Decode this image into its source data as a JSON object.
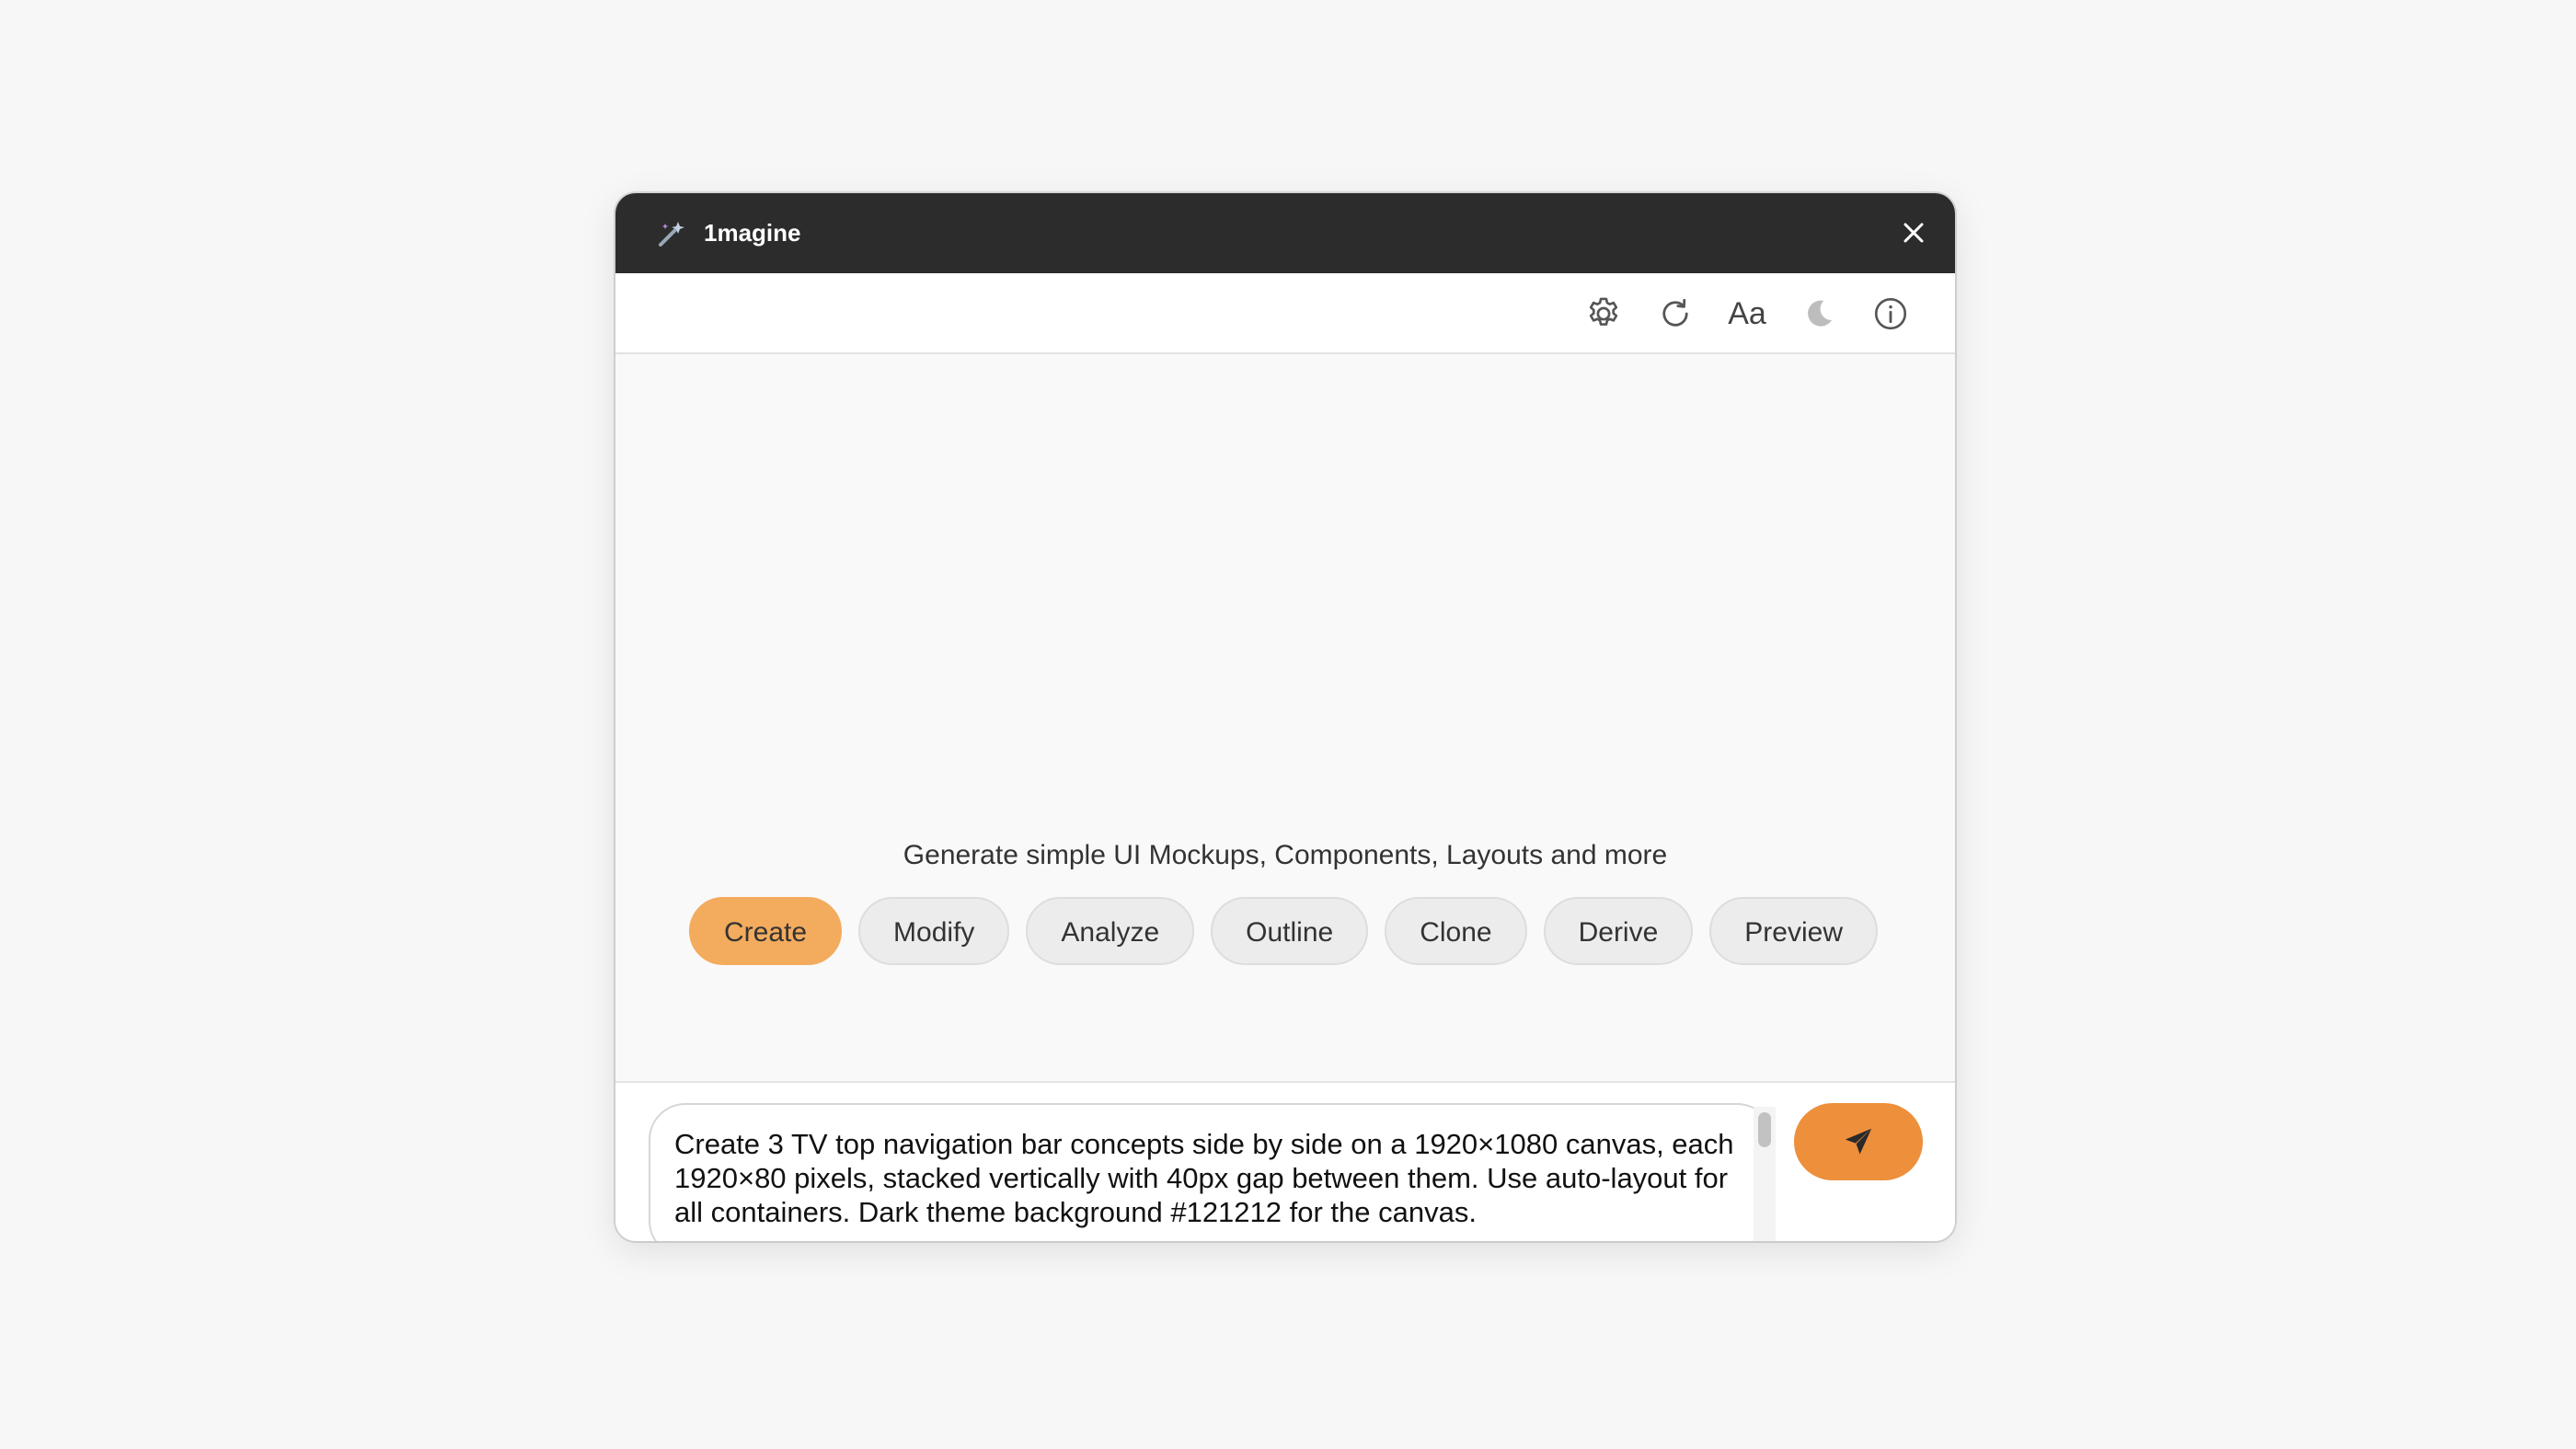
{
  "window": {
    "title": "1magine",
    "close_icon": "close-icon",
    "app_icon": "magic-wand-icon"
  },
  "toolbar": {
    "items": [
      {
        "icon": "gear-icon"
      },
      {
        "icon": "refresh-icon"
      },
      {
        "icon": "font-size-icon",
        "label": "Aa"
      },
      {
        "icon": "moon-icon"
      },
      {
        "icon": "info-icon"
      }
    ]
  },
  "main": {
    "tagline": "Generate simple UI Mockups, Components, Layouts and more",
    "modes": [
      {
        "label": "Create",
        "active": true
      },
      {
        "label": "Modify",
        "active": false
      },
      {
        "label": "Analyze",
        "active": false
      },
      {
        "label": "Outline",
        "active": false
      },
      {
        "label": "Clone",
        "active": false
      },
      {
        "label": "Derive",
        "active": false
      },
      {
        "label": "Preview",
        "active": false
      }
    ]
  },
  "prompt": {
    "value": "Create 3 TV top navigation bar concepts side by side on a 1920×1080 canvas, each 1920×80 pixels, stacked vertically with 40px gap between them. Use auto-layout for all containers. Dark theme background #121212 for the canvas.",
    "send_icon": "send-icon"
  },
  "colors": {
    "titlebar": "#2c2c2c",
    "accent": "#f3ab5d",
    "send": "#ed8f3b",
    "background": "#f7f7f7"
  }
}
